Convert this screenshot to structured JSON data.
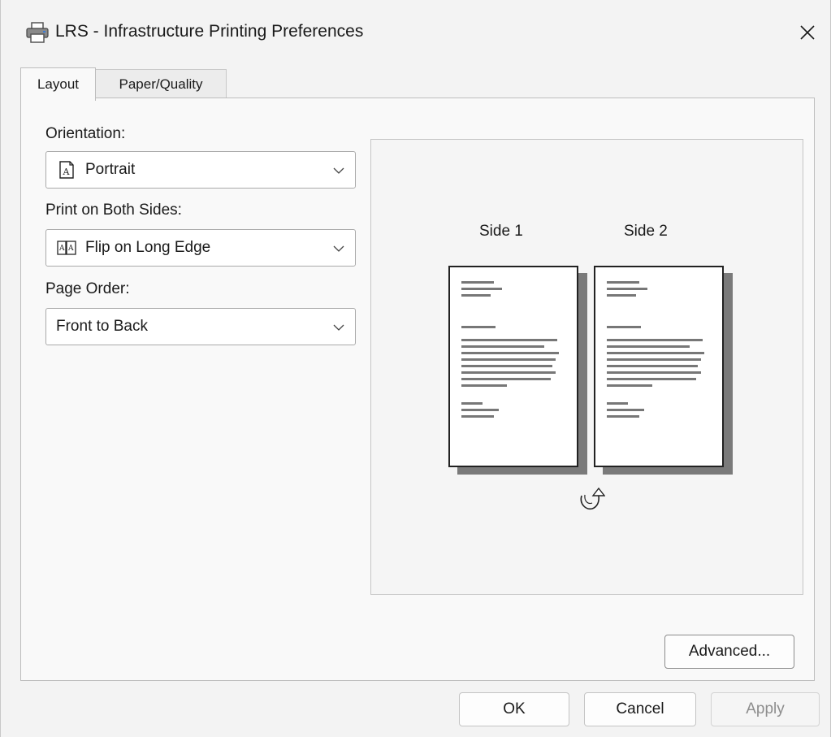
{
  "window": {
    "title": "LRS - Infrastructure Printing Preferences"
  },
  "tabs": [
    {
      "label": "Layout",
      "active": true
    },
    {
      "label": "Paper/Quality",
      "active": false
    }
  ],
  "layout": {
    "orientation": {
      "label": "Orientation:",
      "value": "Portrait",
      "icon": "portrait-page-icon"
    },
    "duplex": {
      "label": "Print on Both Sides:",
      "value": "Flip on Long Edge",
      "icon": "book-flip-icon"
    },
    "page_order": {
      "label": "Page Order:",
      "value": "Front to Back"
    }
  },
  "preview": {
    "side1_label": "Side 1",
    "side2_label": "Side 2",
    "flip_icon": "flip-rotate-icon"
  },
  "buttons": {
    "advanced": "Advanced...",
    "ok": "OK",
    "cancel": "Cancel",
    "apply": "Apply",
    "apply_enabled": false
  },
  "icons": {
    "window": "printer-icon",
    "close": "close-icon"
  },
  "colors": {
    "window_bg": "#f3f3f3",
    "panel_bg": "#f9f9f9",
    "border": "#bdbdbd",
    "disabled_text": "#8d8d8d"
  }
}
